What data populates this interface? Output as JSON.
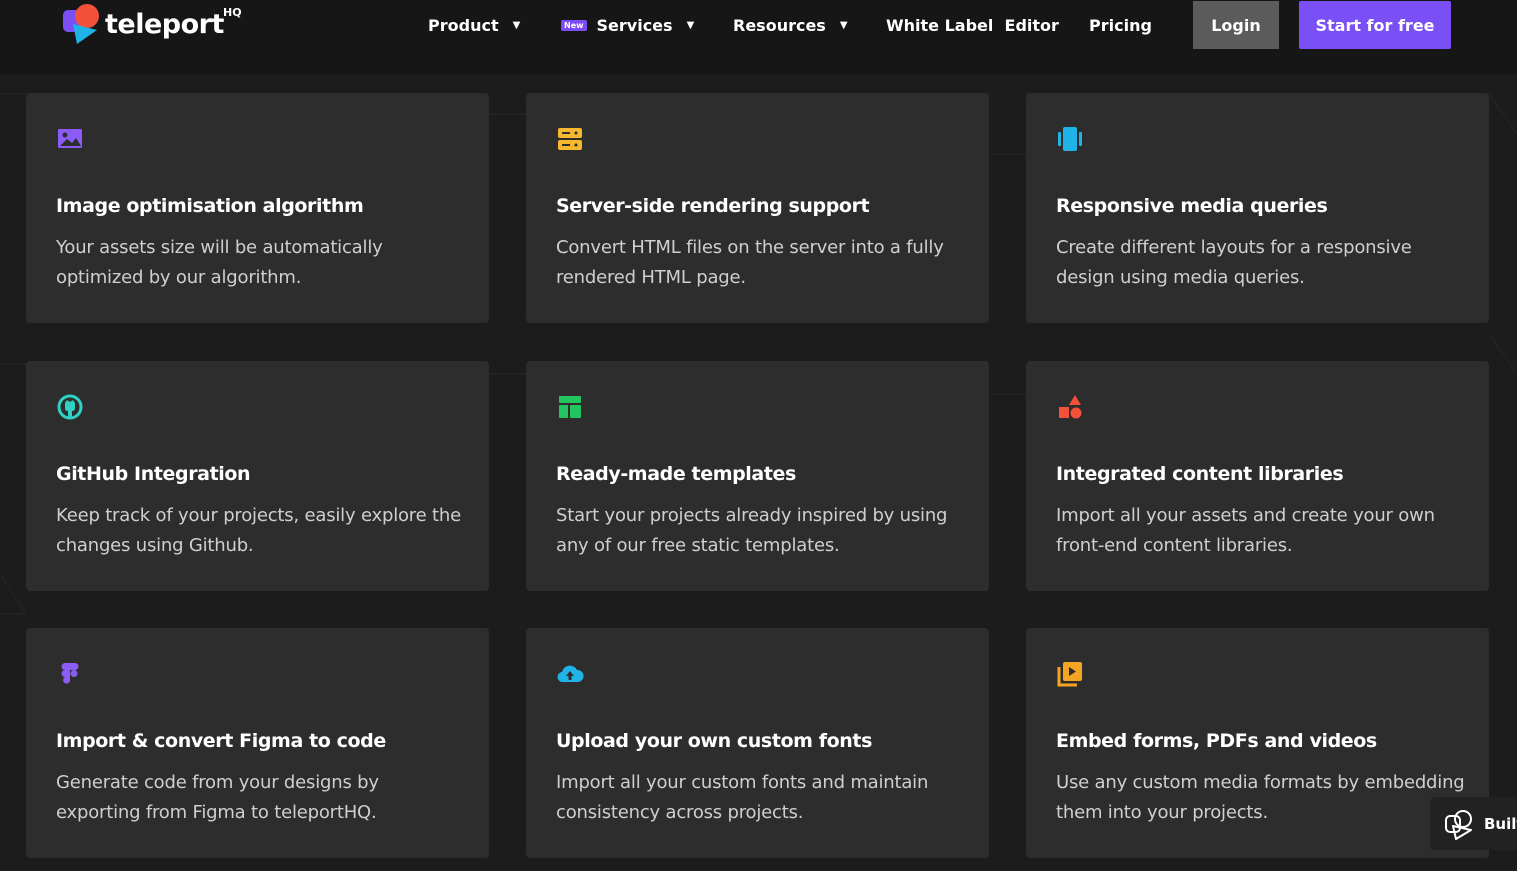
{
  "brand": {
    "name": "teleport",
    "suffix": "HQ"
  },
  "nav": {
    "product": "Product",
    "services_badge": "New",
    "services": "Services",
    "resources": "Resources",
    "white_label": "White Label  Editor",
    "pricing": "Pricing",
    "login": "Login",
    "start": "Start for free"
  },
  "colors": {
    "accent": "#7a4ff5",
    "card_bg": "#2d2d2d",
    "page_bg": "#1c1c1c"
  },
  "features": [
    {
      "icon": "image-icon",
      "icon_color": "#8b5cf6",
      "title": "Image optimisation algorithm",
      "desc": "Your assets size will be automatically optimized by our algorithm."
    },
    {
      "icon": "server-icon",
      "icon_color": "#f5b82e",
      "title": "Server-side rendering support",
      "desc": "Convert HTML files on the server into a fully rendered HTML page."
    },
    {
      "icon": "mobile-icon",
      "icon_color": "#1fb3e8",
      "title": "Responsive media queries",
      "desc": "Create different layouts for a responsive design using media queries."
    },
    {
      "icon": "github-icon",
      "icon_color": "#2ed1c4",
      "title": "GitHub Integration",
      "desc": "Keep track of your projects, easily explore the changes using Github."
    },
    {
      "icon": "template-icon",
      "icon_color": "#22c55e",
      "title": "Ready-made templates",
      "desc": "Start your projects already inspired by using any of our free static templates."
    },
    {
      "icon": "shapes-icon",
      "icon_color": "#f4513a",
      "title": "Integrated content libraries",
      "desc": "Import all your assets and create your own front-end content libraries."
    },
    {
      "icon": "figma-icon",
      "icon_color": "#8b5cf6",
      "title": "Import & convert Figma to code",
      "desc": "Generate code from your designs by exporting from Figma to teleportHQ."
    },
    {
      "icon": "cloud-upload-icon",
      "icon_color": "#1fb3e8",
      "title": "Upload your own custom fonts",
      "desc": "Import all your custom fonts and maintain consistency across projects."
    },
    {
      "icon": "video-icon",
      "icon_color": "#f5a524",
      "title": "Embed forms, PDFs and videos",
      "desc": "Use any custom media formats by embedding them into your projects."
    }
  ],
  "widget": {
    "label": "Built"
  }
}
